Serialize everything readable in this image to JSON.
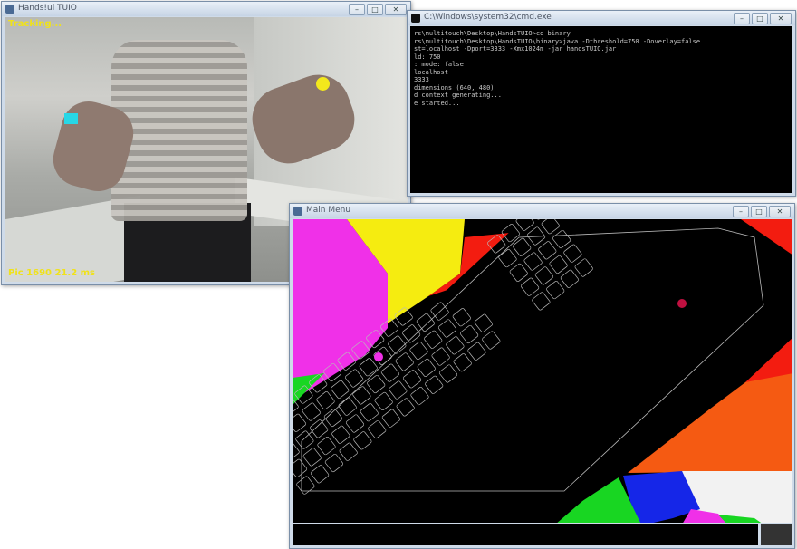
{
  "camera_window": {
    "title": "Hands!ui TUIO",
    "label_top": "Tracking...",
    "label_bottom": "Pic 1690  21.2 ms",
    "min_glyph": "–",
    "max_glyph": "□",
    "close_glyph": "✕"
  },
  "console_window": {
    "title": "C:\\Windows\\system32\\cmd.exe",
    "min_glyph": "–",
    "max_glyph": "□",
    "close_glyph": "✕",
    "lines": [
      "rs\\multitouch\\Desktop\\HandsTUIO>cd binary",
      "rs\\multitouch\\Desktop\\HandsTUIO\\binary>java -Dthreshold=750 -Doverlay=false",
      "st=localhost -Dport=3333 -Xmx1024m -jar handsTUIO.jar",
      "ld: 750",
      ": mode: false",
      " localhost",
      "3333",
      "dimensions (640, 480)",
      "d context generating...",
      "e started..."
    ]
  },
  "main_window": {
    "title": "Main Menu",
    "min_glyph": "–",
    "max_glyph": "□",
    "close_glyph": "✕"
  },
  "colors": {
    "magenta": "#f030e8",
    "yellow": "#f5ec10",
    "red": "#f31c10",
    "orange": "#f55a12",
    "green": "#18d622",
    "blue": "#1526e8",
    "white": "#f2f2f2",
    "key_outline": "#b9b9b9"
  }
}
